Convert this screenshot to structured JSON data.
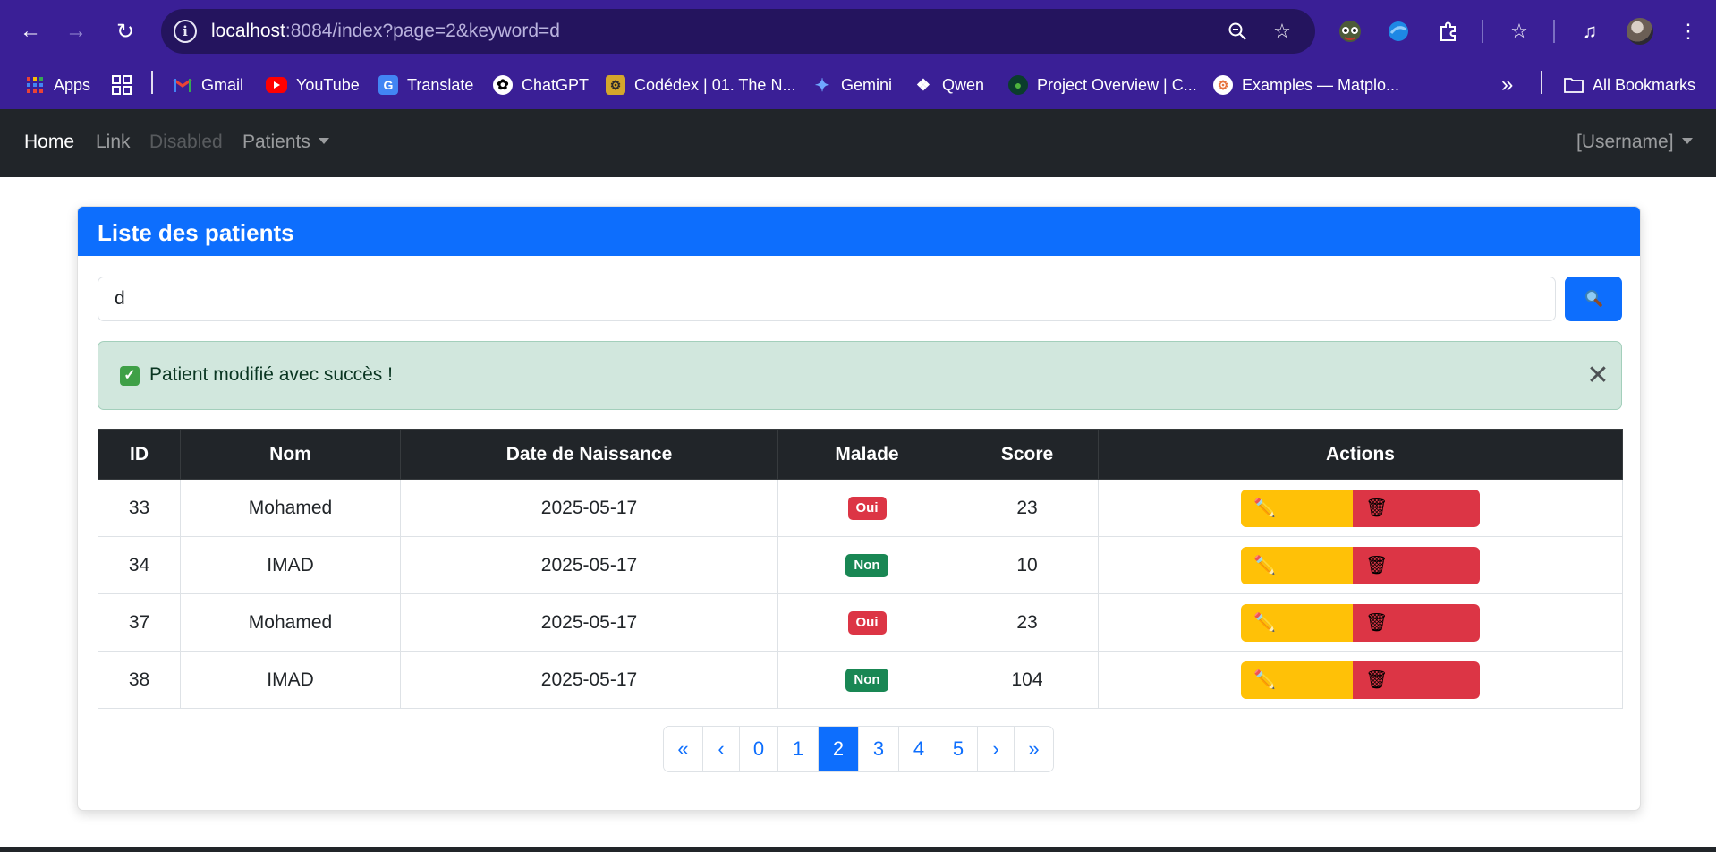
{
  "browser": {
    "url_host": "localhost",
    "url_rest": ":8084/index?page=2&keyword=d",
    "bookmarks": [
      {
        "label": "Apps",
        "icon": "apps-grid-icon"
      },
      {
        "label": "Gmail",
        "icon": "gmail-icon"
      },
      {
        "label": "YouTube",
        "icon": "youtube-icon"
      },
      {
        "label": "Translate",
        "icon": "translate-icon"
      },
      {
        "label": "ChatGPT",
        "icon": "chatgpt-icon"
      },
      {
        "label": "Codédex | 01. The N...",
        "icon": "codedex-icon"
      },
      {
        "label": "Gemini",
        "icon": "gemini-icon"
      },
      {
        "label": "Qwen",
        "icon": "qwen-icon"
      },
      {
        "label": "Project Overview | C...",
        "icon": "mongodb-icon"
      },
      {
        "label": "Examples — Matplo...",
        "icon": "matplotlib-icon"
      }
    ],
    "all_bookmarks": "All Bookmarks"
  },
  "navbar": {
    "home": "Home",
    "link": "Link",
    "disabled": "Disabled",
    "patients": "Patients",
    "username": "[Username]"
  },
  "card": {
    "title": "Liste des patients",
    "search_value": "d",
    "alert_text": "Patient modifié avec succès !"
  },
  "table": {
    "headers": [
      "ID",
      "Nom",
      "Date de Naissance",
      "Malade",
      "Score",
      "Actions"
    ],
    "rows": [
      {
        "id": "33",
        "nom": "Mohamed",
        "date": "2025-05-17",
        "malade": "Oui",
        "score": "23"
      },
      {
        "id": "34",
        "nom": "IMAD",
        "date": "2025-05-17",
        "malade": "Non",
        "score": "10"
      },
      {
        "id": "37",
        "nom": "Mohamed",
        "date": "2025-05-17",
        "malade": "Oui",
        "score": "23"
      },
      {
        "id": "38",
        "nom": "IMAD",
        "date": "2025-05-17",
        "malade": "Non",
        "score": "104"
      }
    ]
  },
  "pagination": {
    "first": "«",
    "prev": "‹",
    "pages": [
      "0",
      "1",
      "2",
      "3",
      "4",
      "5"
    ],
    "current": "2",
    "next": "›",
    "last": "»"
  },
  "colors": {
    "primary": "#0d6efd",
    "danger": "#dc3545",
    "success": "#198754",
    "warning": "#ffc107",
    "dark": "#212529",
    "browser_chrome": "#3a1f96"
  }
}
